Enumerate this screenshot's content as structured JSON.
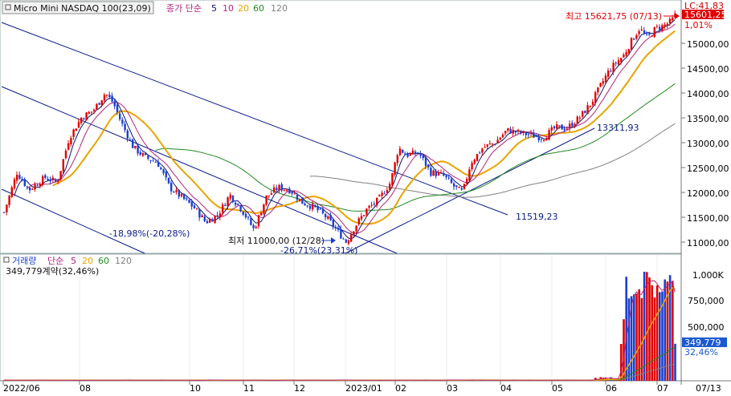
{
  "price_panel": {
    "symbol_button": "Micro Mini NASDAQ 100(23,09)",
    "indicator_label": "종가 단순",
    "ma_periods": [
      "5",
      "10",
      "20",
      "60",
      "120"
    ],
    "y_ticks": [
      "15000,00",
      "14500,00",
      "14000,00",
      "13500,00",
      "13000,00",
      "12500,00",
      "12000,00",
      "11500,00",
      "11000,00"
    ],
    "top_right": {
      "lc": "LC:41,83",
      "last_price": "15601,25",
      "change_pct": "1,01%"
    },
    "annotations": {
      "high": "최고 15621,75 (07/13)",
      "low": "최저 11000,00 (12/28)",
      "low_pct": "-26,71%(23,31%)",
      "left_pct": "-18,98%(-20,28%)",
      "line_value_1": "13311,93",
      "line_value_2": "11519,23"
    }
  },
  "volume_panel": {
    "label": "거래량",
    "indicator_label": "단순",
    "ma_periods": [
      "5",
      "20",
      "60",
      "120"
    ],
    "summary": "349,779계약(32,46%)",
    "y_ticks": [
      "1,000K",
      "750,000",
      "500,000"
    ],
    "last_volume": "349,779",
    "last_volume_pct": "32,46%"
  },
  "x_axis": {
    "labels": [
      "2022/06",
      "08",
      "10",
      "11",
      "12",
      "2023/01",
      "02",
      "03",
      "04",
      "05",
      "06",
      "07",
      "07/13"
    ]
  },
  "colors": {
    "up": "#e00000",
    "down": "#1a3fd0",
    "ma5": "#0a1470",
    "ma10": "#b4237a",
    "ma20": "#e8a400",
    "ma60": "#208a20",
    "ma120": "#808080",
    "trendline": "#0a1a8a",
    "axis_highlight": "#1a5ad0"
  }
}
